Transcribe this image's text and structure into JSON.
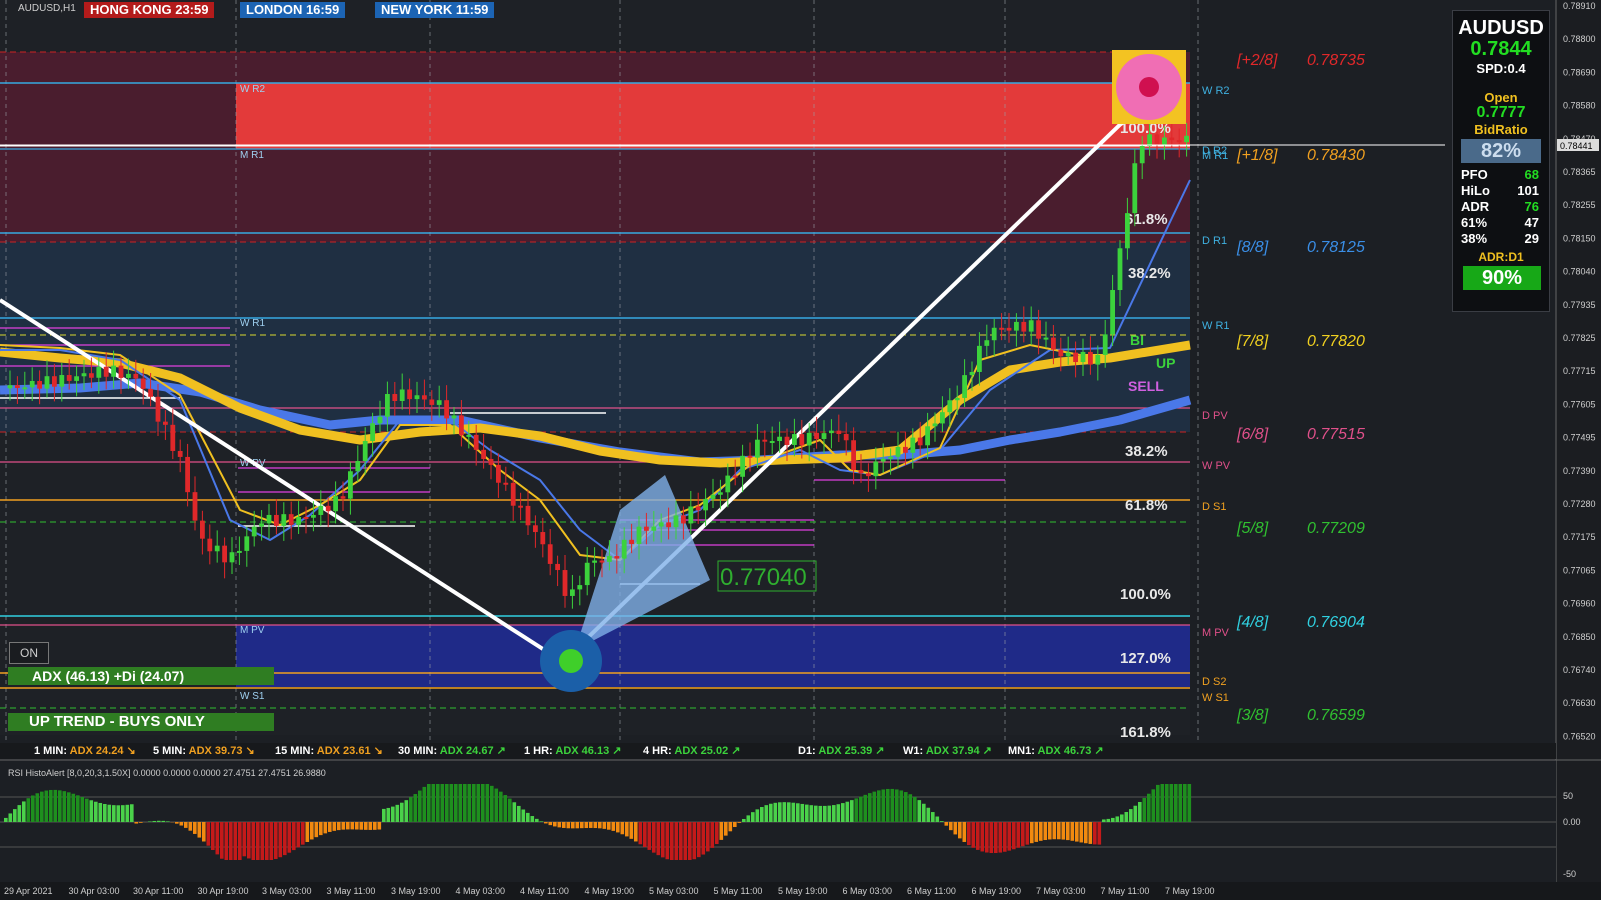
{
  "symbol_tag": "AUDUSD,H1",
  "clocks": [
    {
      "label": "HONG KONG 23:59",
      "color": "#b31b1b"
    },
    {
      "label": "LONDON 16:59",
      "color": "#1c64b4"
    },
    {
      "label": "NEW YORK 11:59",
      "color": "#1c64b4"
    }
  ],
  "info_panel": {
    "symbol": "AUDUSD",
    "price": "0.7844",
    "spread": "SPD:0.4",
    "open_label": "Open",
    "open_value": "0.7777",
    "bidratio_label": "BidRatio",
    "bidratio_value": "82%",
    "stats": [
      {
        "k": "PFO",
        "v": "68"
      },
      {
        "k": "HiLo",
        "v": "101"
      },
      {
        "k": "ADR",
        "v": "76"
      },
      {
        "k": "61%",
        "v": "47"
      },
      {
        "k": "38%",
        "v": "29"
      }
    ],
    "adr_d1_label": "ADR:D1",
    "adr_d1_value": "90%"
  },
  "on_button": "ON",
  "adx_label": "ADX (46.13)   +Di (24.07)",
  "trend_label": "UP TREND - BUYS ONLY",
  "adx_strip": [
    {
      "tf": "1 MIN:",
      "val": "ADX 24.24",
      "arrow": "down",
      "color": "#f0a020"
    },
    {
      "tf": "5 MIN:",
      "val": "ADX 39.73",
      "arrow": "down",
      "color": "#f0a020"
    },
    {
      "tf": "15 MIN:",
      "val": "ADX 23.61",
      "arrow": "down",
      "color": "#f0a020"
    },
    {
      "tf": "30 MIN:",
      "val": "ADX 24.67",
      "arrow": "up",
      "color": "#3cd23c"
    },
    {
      "tf": "1 HR:",
      "val": "ADX 46.13",
      "arrow": "up",
      "color": "#3cd23c"
    },
    {
      "tf": "4 HR:",
      "val": "ADX 25.02",
      "arrow": "up",
      "color": "#3cd23c"
    },
    {
      "tf": "D1:",
      "val": "ADX 25.39",
      "arrow": "up",
      "color": "#3cd23c"
    },
    {
      "tf": "W1:",
      "val": "ADX 37.94",
      "arrow": "up",
      "color": "#3cd23c"
    },
    {
      "tf": "MN1:",
      "val": "ADX 46.73",
      "arrow": "up",
      "color": "#3cd23c"
    }
  ],
  "rsi_label": "RSI HistoAlert [8,0,20,3,1.50X] 0.0000 0.0000 0.0000 27.4751 27.4751 26.9880",
  "chart_data": {
    "type": "candlestick",
    "symbol": "AUDUSD",
    "timeframe": "H1",
    "y_range": [
      0.7648,
      0.7894
    ],
    "price_axis_ticks": [
      "0.78910",
      "0.78800",
      "0.78690",
      "0.78580",
      "0.78470",
      "0.78365",
      "0.78255",
      "0.78150",
      "0.78040",
      "0.77935",
      "0.77825",
      "0.77715",
      "0.77605",
      "0.77495",
      "0.77390",
      "0.77280",
      "0.77175",
      "0.77065",
      "0.76960",
      "0.76850",
      "0.76740",
      "0.76630",
      "0.76520"
    ],
    "current_price_tag": "0.78441",
    "time_axis_labels": [
      "29 Apr 2021",
      "30 Apr 03:00",
      "30 Apr 11:00",
      "30 Apr 19:00",
      "3 May 03:00",
      "3 May 11:00",
      "3 May 19:00",
      "4 May 03:00",
      "4 May 11:00",
      "4 May 19:00",
      "5 May 03:00",
      "5 May 11:00",
      "5 May 19:00",
      "6 May 03:00",
      "6 May 11:00",
      "6 May 19:00",
      "7 May 03:00",
      "7 May 11:00",
      "7 May 19:00"
    ],
    "murrey_levels": [
      {
        "label": "[+2/8]",
        "value": "0.78735",
        "price": 0.78735,
        "color": "#e0282a"
      },
      {
        "label": "[+1/8]",
        "value": "0.78430",
        "price": 0.7843,
        "color": "#f0a020"
      },
      {
        "label": "[8/8]",
        "value": "0.78125",
        "price": 0.78125,
        "color": "#3a8ee6"
      },
      {
        "label": "[7/8]",
        "value": "0.77820",
        "price": 0.7782,
        "color": "#f0d020"
      },
      {
        "label": "[6/8]",
        "value": "0.77515",
        "price": 0.77515,
        "color": "#e0508a"
      },
      {
        "label": "[5/8]",
        "value": "0.77209",
        "price": 0.77209,
        "color": "#30c030"
      },
      {
        "label": "[4/8]",
        "value": "0.76904",
        "price": 0.76904,
        "color": "#30d0e0"
      },
      {
        "label": "[3/8]",
        "value": "0.76599",
        "price": 0.76599,
        "color": "#30c030"
      }
    ],
    "pivot_labels": [
      {
        "label": "W R2",
        "price": 0.7859,
        "color": "#3fb0e0"
      },
      {
        "label": "D R2",
        "price": 0.7845,
        "color": "#3fb0e0"
      },
      {
        "label": "M R1",
        "price": 0.78415,
        "color": "#3fb0e0"
      },
      {
        "label": "D R1",
        "price": 0.7811,
        "color": "#3fb0e0"
      },
      {
        "label": "W R1",
        "price": 0.77855,
        "color": "#3fb0e0"
      },
      {
        "label": "D PV",
        "price": 0.7756,
        "color": "#e0508a"
      },
      {
        "label": "W PV",
        "price": 0.774,
        "color": "#e0508a"
      },
      {
        "label": "D S1",
        "price": 0.7725,
        "color": "#f0a020"
      },
      {
        "label": "M PV",
        "price": 0.7688,
        "color": "#e0508a"
      },
      {
        "label": "D S2",
        "price": 0.767,
        "color": "#f0a020"
      },
      {
        "label": "W S1",
        "price": 0.76665,
        "color": "#f0a020"
      }
    ],
    "fib_labels": [
      "100.0%",
      "61.8%",
      "38.2%",
      "38.2%",
      "61.8%",
      "100.0%",
      "127.0%",
      "161.8%"
    ],
    "annotations": [
      "0.77040",
      "BI",
      "UP",
      "SELL"
    ],
    "rsi_axis": [
      "50",
      "0.00",
      "-50"
    ]
  }
}
